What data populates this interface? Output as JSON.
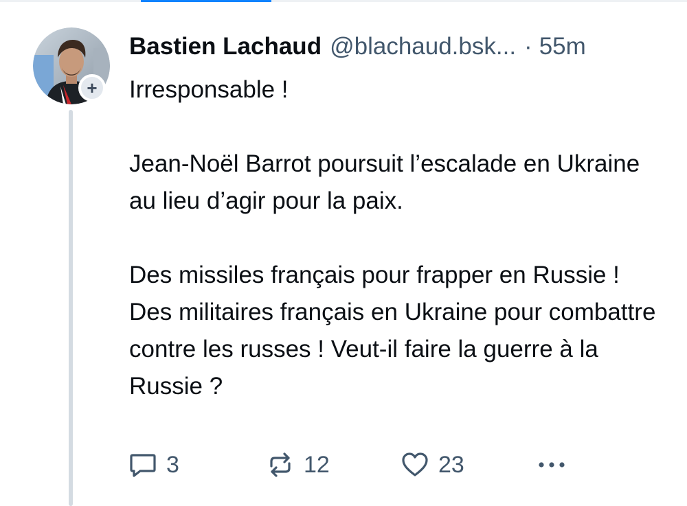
{
  "post": {
    "author": {
      "display_name": "Bastien Lachaud",
      "handle": "@blachaud.bsk...",
      "avatar_icon": "user-avatar",
      "follow_icon": "plus-icon",
      "follow_symbol": "+"
    },
    "separator": "·",
    "timestamp": "55m",
    "paragraphs": [
      "Irresponsable !",
      "Jean-Noël Barrot poursuit l’escalade en Ukraine au lieu d’agir pour la paix.",
      "Des missiles français pour frapper en Russie ! Des militaires français en Ukraine pour combattre contre les russes ! Veut-il faire la guerre à la Russie ?"
    ],
    "actions": {
      "replies": "3",
      "reposts": "12",
      "likes": "23",
      "reply_icon": "reply-icon",
      "repost_icon": "repost-icon",
      "like_icon": "heart-icon",
      "more_icon": "more-icon"
    }
  },
  "colors": {
    "text": "#0b0f14",
    "muted": "#42576c",
    "thread_line": "#d4dbe2",
    "accent": "#1083fe",
    "badge_bg": "#e3e8ee"
  }
}
